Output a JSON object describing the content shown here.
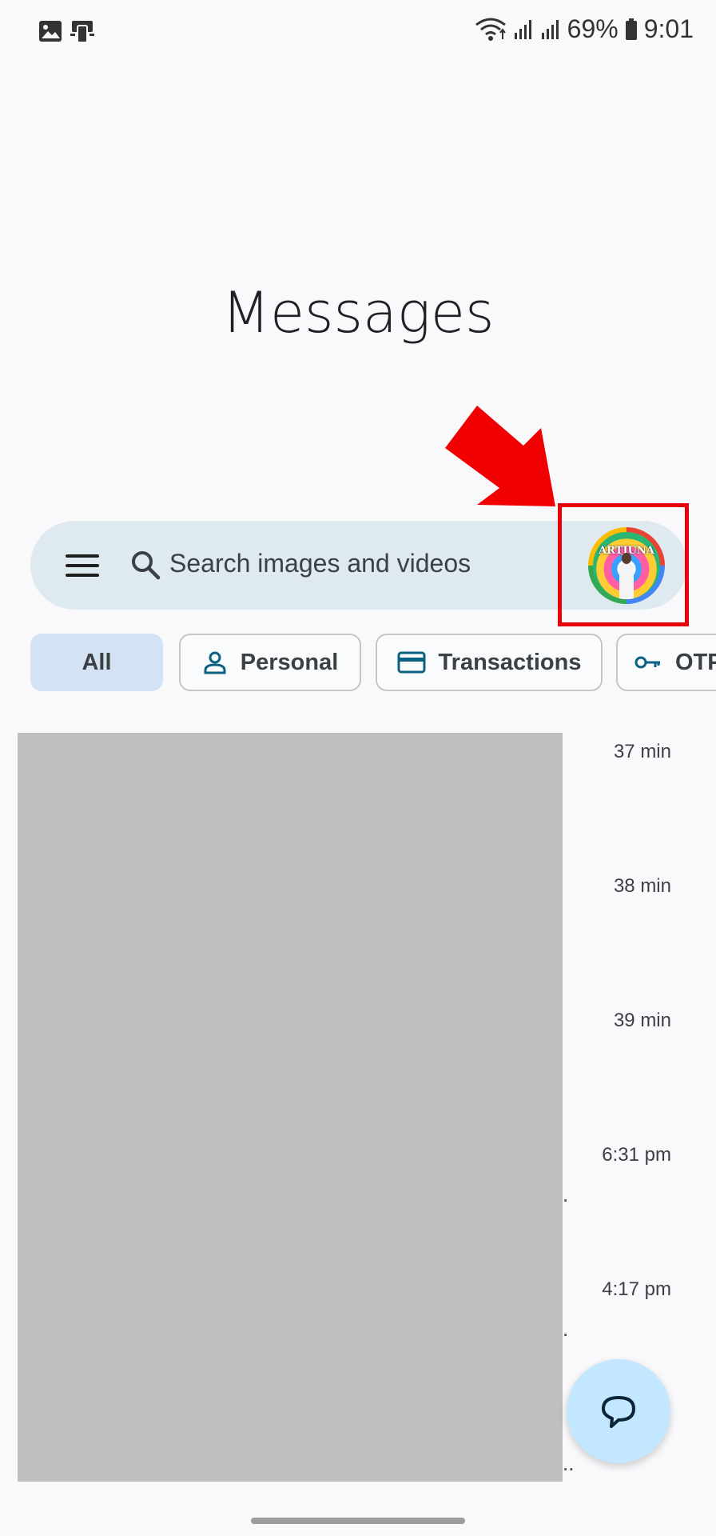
{
  "status_bar": {
    "battery": "69%",
    "time": "9:01"
  },
  "app": {
    "title": "Messages"
  },
  "search": {
    "placeholder": "Search images and videos",
    "avatar_text": "ARTJUNA"
  },
  "chips": [
    {
      "label": "All",
      "selected": true
    },
    {
      "label": "Personal",
      "icon": "person-icon"
    },
    {
      "label": "Transactions",
      "icon": "card-icon"
    },
    {
      "label": "OTP",
      "icon": "key-icon"
    }
  ],
  "conversations": [
    {
      "time": "37 min"
    },
    {
      "time": "38 min"
    },
    {
      "time": "39 min"
    },
    {
      "time": "6:31 pm"
    },
    {
      "time": "4:17 pm"
    }
  ],
  "colors": {
    "accent_chip": "#d3e3f4",
    "search_bg": "#dee9f0",
    "fab": "#c2e7ff",
    "highlight": "#e8000a",
    "icon_teal": "#0b6182"
  }
}
